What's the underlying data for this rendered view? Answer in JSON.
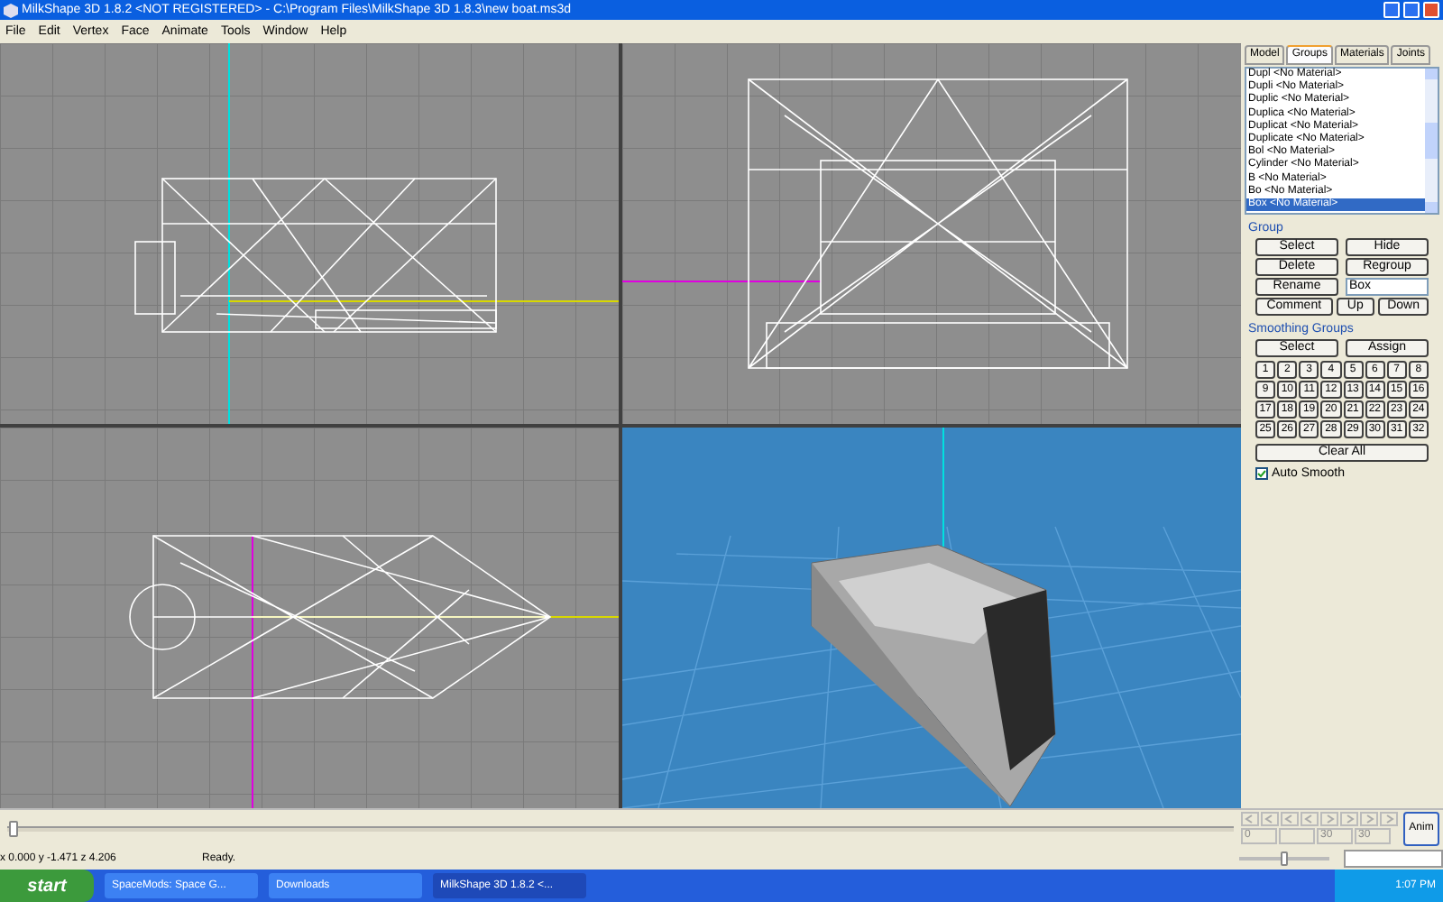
{
  "window": {
    "title": "MilkShape 3D 1.8.2 <NOT REGISTERED> - C:\\Program Files\\MilkShape 3D 1.8.3\\new boat.ms3d"
  },
  "menu": [
    "File",
    "Edit",
    "Vertex",
    "Face",
    "Animate",
    "Tools",
    "Window",
    "Help"
  ],
  "panel": {
    "tabs": [
      {
        "label": "Model",
        "selected": false
      },
      {
        "label": "Groups",
        "selected": true
      },
      {
        "label": "Materials",
        "selected": false
      },
      {
        "label": "Joints",
        "selected": false
      }
    ],
    "groups_list": [
      {
        "label": "Dupl <No Material>",
        "selected": false
      },
      {
        "label": "Dupli <No Material>",
        "selected": false
      },
      {
        "label": "Duplic <No Material>",
        "selected": false
      },
      {
        "label": "Duplica <No Material>",
        "selected": false
      },
      {
        "label": "Duplicat <No Material>",
        "selected": false
      },
      {
        "label": "Duplicate <No Material>",
        "selected": false
      },
      {
        "label": "Bol <No Material>",
        "selected": false
      },
      {
        "label": "Cylinder <No Material>",
        "selected": false
      },
      {
        "label": "B <No Material>",
        "selected": false
      },
      {
        "label": "Bo <No Material>",
        "selected": false
      },
      {
        "label": "Box <No Material>",
        "selected": true
      }
    ],
    "group_heading": "Group",
    "group_buttons": [
      [
        "Select",
        "Hide"
      ],
      [
        "Delete",
        "Regroup"
      ]
    ],
    "rename_button": "Rename",
    "name_value": "Box",
    "comment_button": "Comment",
    "up_button": "Up",
    "down_button": "Down",
    "smoothing_heading": "Smoothing Groups",
    "smoothing_buttons": [
      "Select",
      "Assign"
    ],
    "smoothing_numbers": [
      "1",
      "2",
      "3",
      "4",
      "5",
      "6",
      "7",
      "8",
      "9",
      "10",
      "11",
      "12",
      "13",
      "14",
      "15",
      "16",
      "17",
      "18",
      "19",
      "20",
      "21",
      "22",
      "23",
      "24",
      "25",
      "26",
      "27",
      "28",
      "29",
      "30",
      "31",
      "32"
    ],
    "clear_all": "Clear All",
    "auto_smooth": {
      "label": "Auto Smooth",
      "checked": true
    }
  },
  "animation": {
    "frame_fields": [
      "0",
      "30",
      "30"
    ],
    "anim_button": "Anim",
    "speed": {
      "level": 0.5
    }
  },
  "status_bar": {
    "coordinates": "x 0.000 y -1.471 z 4.206",
    "message": "Ready."
  },
  "taskbar": {
    "start": "start",
    "tasks": [
      {
        "label": "SpaceMods: Space G...",
        "selected": false
      },
      {
        "label": "Downloads",
        "selected": false
      },
      {
        "label": "MilkShape 3D 1.8.2 <...",
        "selected": true
      }
    ],
    "clock": "1:07 PM"
  }
}
